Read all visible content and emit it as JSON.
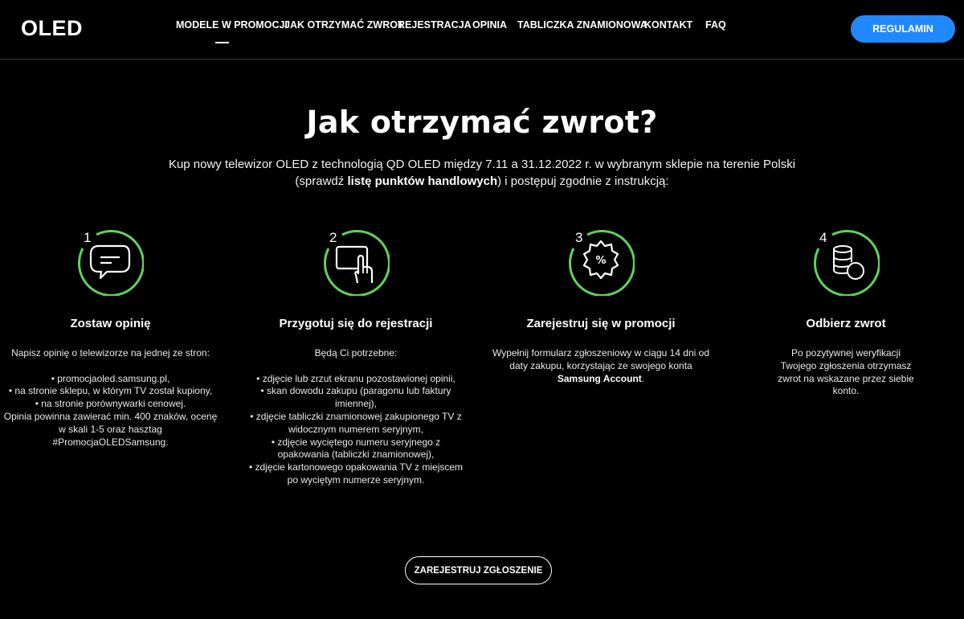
{
  "header": {
    "logo": "OLED",
    "nav": [
      "MODELE W PROMOCJI",
      "JAK OTRZYMAĆ ZWROT",
      "REJESTRACJA",
      "OPINIA",
      "TABLICZKA ZNAMIONOWA",
      "KONTAKT",
      "FAQ"
    ],
    "regulamin_label": "REGULAMIN"
  },
  "hero": {
    "title": "Jak otrzymać zwrot?",
    "lead_line1": "Kup nowy telewizor OLED z technologią QD OLED między 7.11 a 31.12.2022 r. w wybranym sklepie na terenie Polski",
    "lead_pre": "(sprawdź ",
    "lead_link": "listę punktów handlowych",
    "lead_post": ") i postępuj zgodnie z instrukcją:"
  },
  "steps": [
    {
      "number": "1",
      "icon": "chat-bubble-icon",
      "title": "Zostaw opinię",
      "lines": [
        "Napisz opinię o telewizorze na jednej ze stron:",
        "",
        "• promocjaoled.samsung.pl,",
        "• na stronie sklepu, w którym TV został kupiony,",
        "• na stronie porównywarki cenowej.",
        "Opinia powinna zawierać min. 400 znaków, ocenę",
        "w skali 1-5 oraz hasztag #PromocjaOLEDSamsung."
      ]
    },
    {
      "number": "2",
      "icon": "touch-screen-icon",
      "title": "Przygotuj się do rejestracji",
      "lines": [
        "Będą Ci potrzebne:",
        "",
        "• zdjęcie lub zrzut ekranu pozostawionej opinii,",
        "• skan dowodu zakupu (paragonu lub faktury",
        "imiennej),",
        "• zdjęcie tabliczki znamionowej zakupionego TV z",
        "widocznym numerem seryjnym,",
        "• zdjęcie wyciętego numeru seryjnego z",
        "opakowania (tabliczki znamionowej),",
        "• zdjęcie kartonowego opakowania TV z miejscem",
        "po wyciętym numerze seryjnym."
      ]
    },
    {
      "number": "3",
      "icon": "percent-badge-icon",
      "title": "Zarejestruj się w promocji",
      "lines": [
        "Wypełnij formularz zgłoszeniowy w ciągu 14 dni od",
        "daty zakupu, korzystając ze swojego konta"
      ],
      "bold_line": "Samsung Account",
      "bold_suffix": "."
    },
    {
      "number": "4",
      "icon": "coins-stack-icon",
      "title": "Odbierz zwrot",
      "lines": [
        "Po pozytywnej weryfikacji",
        "Twojego zgłoszenia otrzymasz",
        "zwrot na wskazane przez siebie",
        "konto."
      ]
    }
  ],
  "cta_label": "ZAREJESTRUJ ZGŁOSZENIE",
  "colors": {
    "background": "#000000",
    "accent_blue": "#2189ff",
    "ring_green": "#5fd35a"
  }
}
